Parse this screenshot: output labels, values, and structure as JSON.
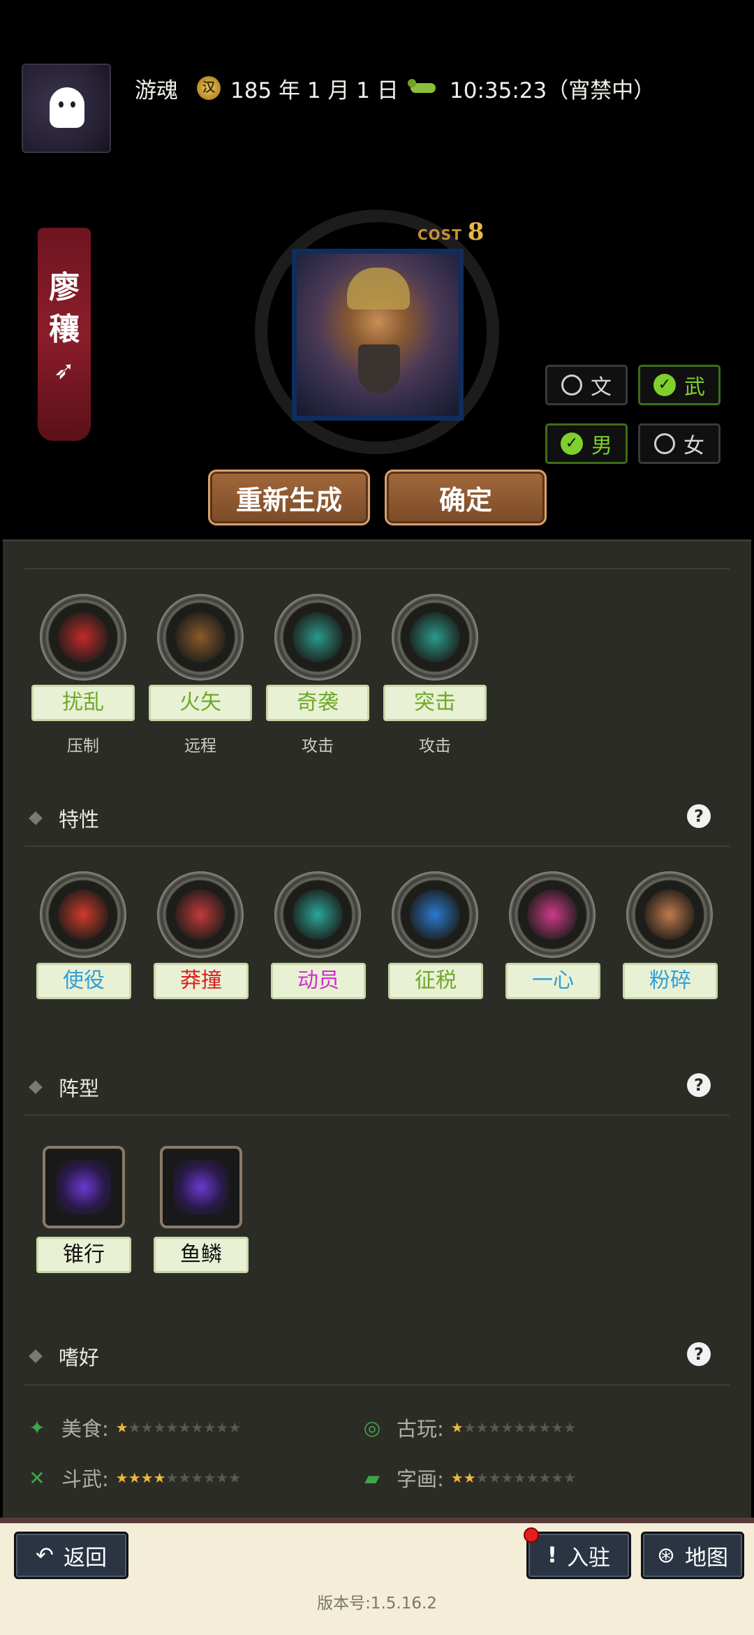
{
  "header": {
    "player_name": "游魂",
    "date": "185 年 1 月 1 日",
    "time": "10:35:23（宵禁中）",
    "coin_glyph": "汉"
  },
  "general": {
    "name_line1": "廖",
    "name_line2": "穰",
    "cost_label": "COST",
    "cost_value": "8"
  },
  "toggles": {
    "wen": "文",
    "wu": "武",
    "male": "男",
    "female": "女",
    "wen_checked": false,
    "wu_checked": true,
    "male_checked": true,
    "female_checked": false
  },
  "actions": {
    "regenerate": "重新生成",
    "confirm": "确定"
  },
  "skills": [
    {
      "name": "扰乱",
      "type": "压制",
      "color": "#6fa82a",
      "icon": "red-cloud-icon"
    },
    {
      "name": "火矢",
      "type": "远程",
      "color": "#6fa82a",
      "icon": "fire-arrow-icon"
    },
    {
      "name": "奇袭",
      "type": "攻击",
      "color": "#6fa82a",
      "icon": "blue-flame-icon"
    },
    {
      "name": "突击",
      "type": "攻击",
      "color": "#6fa82a",
      "icon": "charge-icon"
    }
  ],
  "traits": {
    "title": "特性",
    "items": [
      {
        "name": "使役",
        "color": "#2f9fd6",
        "icon": "rolling-stone-icon"
      },
      {
        "name": "莽撞",
        "color": "#d82020",
        "icon": "scroll-icon"
      },
      {
        "name": "动员",
        "color": "#d02fd0",
        "icon": "banner-icon"
      },
      {
        "name": "征税",
        "color": "#6fa82a",
        "icon": "coin-hand-icon"
      },
      {
        "name": "一心",
        "color": "#2f9fd6",
        "icon": "target-icon"
      },
      {
        "name": "粉碎",
        "color": "#2f9fd6",
        "icon": "shatter-icon"
      }
    ]
  },
  "formations": {
    "title": "阵型",
    "items": [
      {
        "name": "锥行",
        "icon": "wedge-formation-icon"
      },
      {
        "name": "鱼鳞",
        "icon": "fishscale-formation-icon"
      }
    ]
  },
  "preferences": {
    "title": "嗜好",
    "items": [
      {
        "label": "美食:",
        "filled": 1,
        "total": 10,
        "icon": "food-icon"
      },
      {
        "label": "古玩:",
        "filled": 1,
        "total": 10,
        "icon": "antique-icon"
      },
      {
        "label": "斗武:",
        "filled": 4,
        "total": 10,
        "icon": "combat-icon"
      },
      {
        "label": "字画:",
        "filled": 2,
        "total": 10,
        "icon": "painting-icon"
      }
    ]
  },
  "bottom": {
    "back": "返回",
    "enter": "入驻",
    "map": "地图",
    "version": "版本号:1.5.16.2"
  },
  "help_glyph": "?"
}
